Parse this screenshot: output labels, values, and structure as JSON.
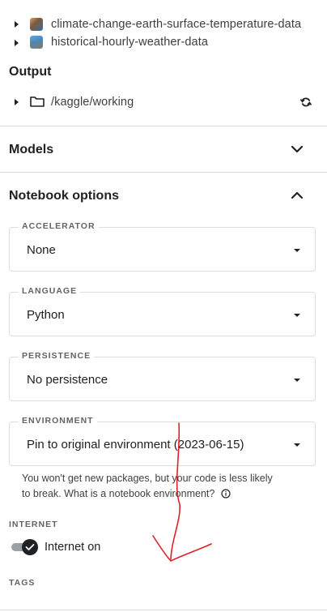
{
  "input": {
    "datasets": [
      {
        "label": "climate-change-earth-surface-temperature-data"
      },
      {
        "label": "historical-hourly-weather-data"
      }
    ]
  },
  "output": {
    "title": "Output",
    "path": "/kaggle/working"
  },
  "models": {
    "title": "Models"
  },
  "notebook_options": {
    "title": "Notebook options",
    "accelerator": {
      "label": "ACCELERATOR",
      "value": "None"
    },
    "language": {
      "label": "LANGUAGE",
      "value": "Python"
    },
    "persistence": {
      "label": "PERSISTENCE",
      "value": "No persistence"
    },
    "environment": {
      "label": "ENVIRONMENT",
      "value": "Pin to original environment (2023-06-15)",
      "help_line1": "You won't get new packages, but your code is less likely",
      "help_line2": "to break. What is a notebook environment?"
    },
    "internet": {
      "label": "INTERNET",
      "toggle_label": "Internet on"
    },
    "tags": {
      "label": "TAGS"
    }
  },
  "colors": {
    "annotation": "#e0202a",
    "toggle_track": "#9aa0a6",
    "toggle_knob": "#202124"
  }
}
